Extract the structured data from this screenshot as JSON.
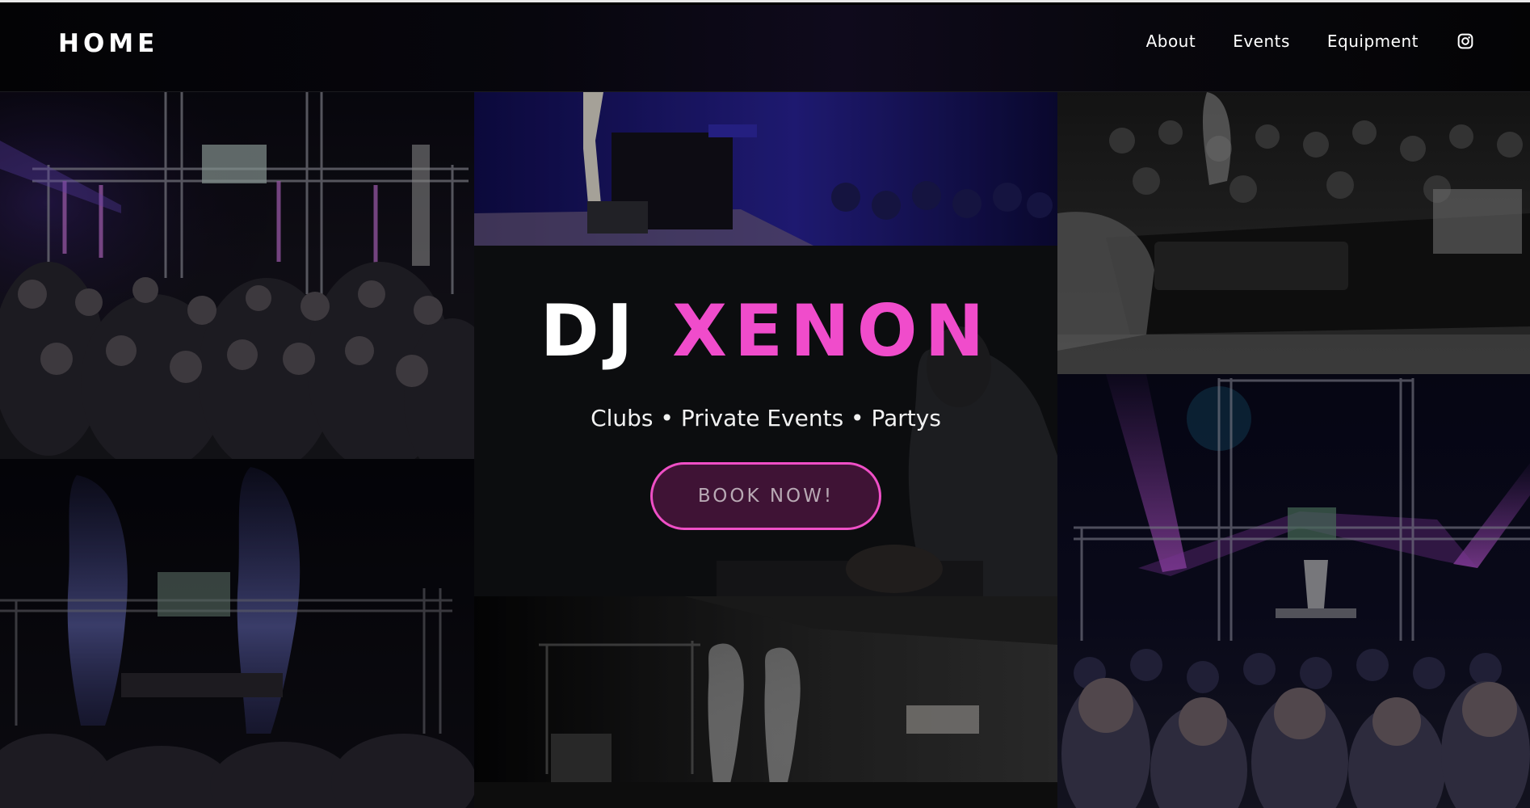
{
  "header": {
    "logo": "HOME",
    "nav": [
      {
        "label": "About"
      },
      {
        "label": "Events"
      },
      {
        "label": "Equipment"
      }
    ],
    "social_icon": "instagram-icon"
  },
  "hero": {
    "title_part1": "DJ",
    "title_part2": "XENON",
    "subtitle": "Clubs • Private Events • Partys",
    "cta_label": "BOOK NOW!"
  },
  "colors": {
    "accent": "#f04ccb",
    "background": "#000000",
    "text": "#ffffff"
  }
}
